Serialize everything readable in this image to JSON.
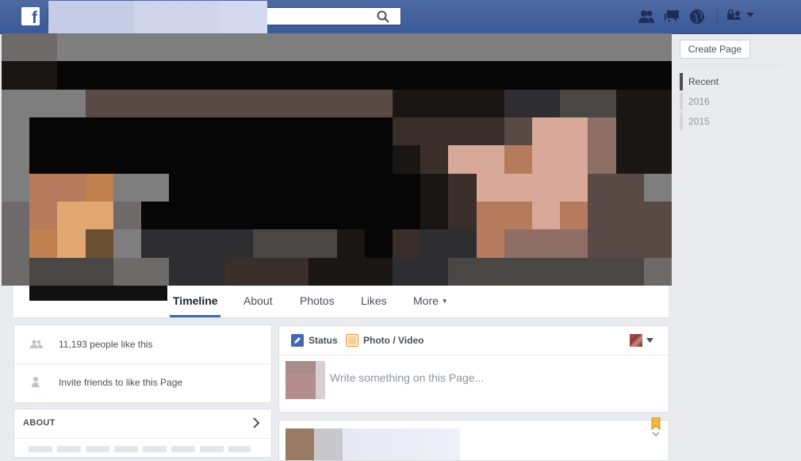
{
  "topbar": {
    "logo_letter": "f",
    "search_placeholder": ""
  },
  "tabs": [
    "Timeline",
    "About",
    "Photos",
    "Likes",
    "More"
  ],
  "right_rail": {
    "create_page_label": "Create Page",
    "years": [
      "Recent",
      "2016",
      "2015"
    ]
  },
  "left": {
    "likes_text": "11,193 people like this",
    "invite_text": "Invite friends to like this Page",
    "about_title": "ABOUT"
  },
  "composer": {
    "status_label": "Status",
    "photo_label": "Photo / Video",
    "placeholder": "Write something on this Page..."
  },
  "colors": {
    "brand_blue": "#3b5998",
    "link_blue": "#4267b2",
    "background": "#e9ebee"
  }
}
